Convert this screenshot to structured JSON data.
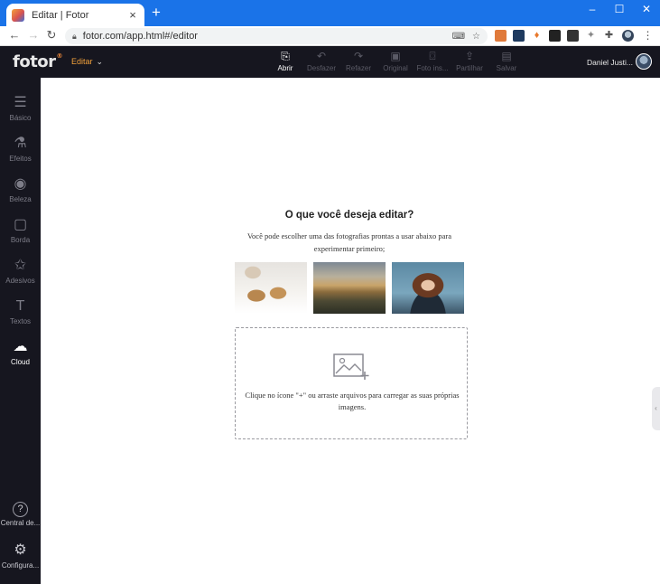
{
  "browser": {
    "tab_title": "Editar | Fotor",
    "tab_close": "×",
    "new_tab": "+",
    "url": "fotor.com/app.html#/editor",
    "window_controls": {
      "minimize": "–",
      "maximize": "☐",
      "close": "✕"
    }
  },
  "app": {
    "logo": "fotor",
    "logo_mark": "®",
    "mode_label": "Editar",
    "toolbar": [
      {
        "label": "Abrir",
        "icon": "open-image-icon",
        "glyph": "⎘",
        "active": true
      },
      {
        "label": "Desfazer",
        "icon": "undo-icon",
        "glyph": "↶",
        "active": false
      },
      {
        "label": "Refazer",
        "icon": "redo-icon",
        "glyph": "↷",
        "active": false
      },
      {
        "label": "Original",
        "icon": "original-icon",
        "glyph": "▣",
        "active": false
      },
      {
        "label": "Foto ins...",
        "icon": "photo-inspect-icon",
        "glyph": "⌼",
        "active": false
      },
      {
        "label": "Partilhar",
        "icon": "share-icon",
        "glyph": "⇪",
        "active": false
      },
      {
        "label": "Salvar",
        "icon": "save-icon",
        "glyph": "▤",
        "active": false
      }
    ],
    "user_name": "Daniel Justi..."
  },
  "sidebar": {
    "items": [
      {
        "label": "Básico",
        "icon": "sliders-icon",
        "glyph": "☰",
        "active": false
      },
      {
        "label": "Efeitos",
        "icon": "flask-icon",
        "glyph": "⚗",
        "active": false
      },
      {
        "label": "Beleza",
        "icon": "eye-icon",
        "glyph": "◉",
        "active": false
      },
      {
        "label": "Borda",
        "icon": "frame-icon",
        "glyph": "▢",
        "active": false
      },
      {
        "label": "Adesivos",
        "icon": "sticker-icon",
        "glyph": "✩",
        "active": false
      },
      {
        "label": "Textos",
        "icon": "text-icon",
        "glyph": "T",
        "active": false
      },
      {
        "label": "Cloud",
        "icon": "cloud-upload-icon",
        "glyph": "☁",
        "active": true
      }
    ],
    "bottom_items": [
      {
        "label": "Central de...",
        "icon": "help-icon",
        "glyph": "?"
      },
      {
        "label": "Configura...",
        "icon": "settings-icon",
        "glyph": "⚙"
      }
    ]
  },
  "editor": {
    "heading": "O que você deseja editar?",
    "subtext": "Você pode escolher uma das fotografias prontas a usar abaixo para experimentar primeiro;",
    "samples": [
      {
        "name": "sample-cookies"
      },
      {
        "name": "sample-hills"
      },
      {
        "name": "sample-portrait"
      }
    ],
    "drop_text": "Clique no ícone \"+\" ou arraste arquivos para carregar as suas próprias imagens."
  }
}
